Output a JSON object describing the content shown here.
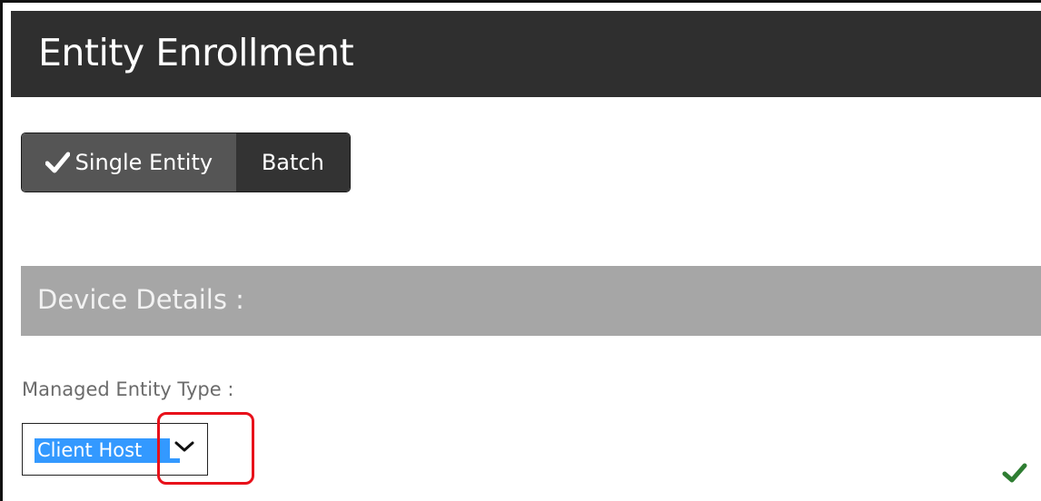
{
  "header": {
    "title": "Entity Enrollment"
  },
  "mode_toggle": {
    "single_label": "Single Entity",
    "batch_label": "Batch",
    "selected": "Single Entity"
  },
  "section": {
    "title": "Device Details :"
  },
  "form": {
    "entity_type_label": "Managed Entity Type :",
    "entity_type_value": "Client Host"
  },
  "icons": {
    "selected_check": "checkmark-icon",
    "dropdown": "chevron-down-icon",
    "validation": "checkmark-icon"
  },
  "colors": {
    "header_bg": "#2f2f2f",
    "segment_selected": "#555555",
    "segment_unselected": "#333333",
    "section_bg": "#a6a6a6",
    "selection_highlight": "#3399ff",
    "callout": "#e8101a",
    "valid_check": "#2e7d32"
  }
}
